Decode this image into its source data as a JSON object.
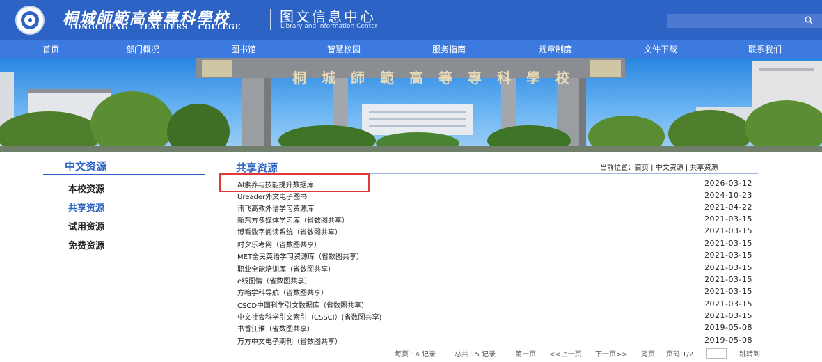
{
  "header": {
    "college_cn": "桐城師範高等專科學校",
    "college_en": "TONGCHENG TEACHERS COLLEGE",
    "library_cn": "图文信息中心",
    "library_en": "Library and Information Center",
    "search_placeholder": "",
    "search_icon": "search-icon"
  },
  "nav": {
    "items": [
      {
        "label": "首页"
      },
      {
        "label": "部门概况"
      },
      {
        "label": "图书馆"
      },
      {
        "label": "智慧校园"
      },
      {
        "label": "服务指南"
      },
      {
        "label": "规章制度"
      },
      {
        "label": "文件下载"
      },
      {
        "label": "联系我们"
      }
    ]
  },
  "banner": {
    "gate_text": "桐城師範高等專科學校"
  },
  "sidebar": {
    "title": "中文资源",
    "items": [
      {
        "label": "本校资源"
      },
      {
        "label": "共享资源"
      },
      {
        "label": "试用资源"
      },
      {
        "label": "免费资源"
      }
    ],
    "active_index": 1
  },
  "main": {
    "title": "共享资源",
    "breadcrumb": "当前位置：首页 | 中文资源 | 共享资源",
    "list": [
      {
        "title": "AI素养与技能提升数据库",
        "date": "2026-03-12"
      },
      {
        "title": "Ureader外文电子图书",
        "date": "2024-10-23"
      },
      {
        "title": "讯飞高教外语学习资源库",
        "date": "2021-04-22"
      },
      {
        "title": "新东方多媒体学习库（省数图共享）",
        "date": "2021-03-15"
      },
      {
        "title": "博看数字阅读系统（省数图共享）",
        "date": "2021-03-15"
      },
      {
        "title": "时夕乐考网（省数图共享）",
        "date": "2021-03-15"
      },
      {
        "title": "MET全民英语学习资源库（省数图共享）",
        "date": "2021-03-15"
      },
      {
        "title": "职业全能培训库（省数图共享）",
        "date": "2021-03-15"
      },
      {
        "title": "e线图情（省数图共享）",
        "date": "2021-03-15"
      },
      {
        "title": "方略学科导航（省数图共享）",
        "date": "2021-03-15"
      },
      {
        "title": "CSCD中国科学引文数据库（省数图共享）",
        "date": "2021-03-15"
      },
      {
        "title": "中文社会科学引文索引（CSSCI）(省数图共享)",
        "date": "2021-03-15"
      },
      {
        "title": "书香江淮（省数图共享）",
        "date": "2019-05-08"
      },
      {
        "title": "万方中文电子期刊（省数图共享）",
        "date": "2019-05-08"
      }
    ]
  },
  "pager": {
    "per_page": "每页 14 记录",
    "total": "总共 15 记录",
    "first": "第一页",
    "prev": "<<上一页",
    "next": "下一页>>",
    "last": "尾页",
    "page_info": "页码 1/2",
    "jump": "跳转到"
  },
  "colors": {
    "header_bg": "#2d63c4",
    "nav_bg": "#3d7ae0",
    "accent": "#2d63c4",
    "highlight_border": "#e23a3a"
  }
}
